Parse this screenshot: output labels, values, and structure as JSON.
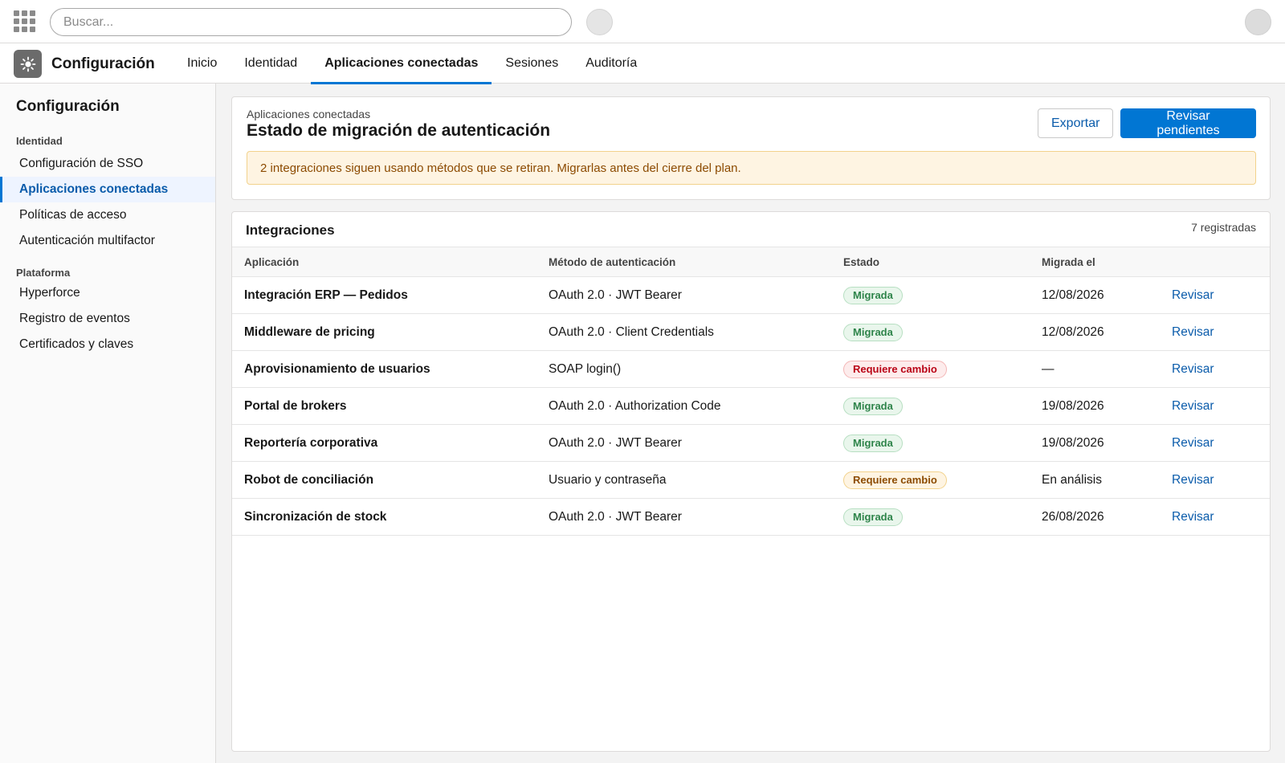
{
  "topbar": {
    "search_placeholder": "Buscar..."
  },
  "nav": {
    "app_name": "Configuración",
    "tabs": [
      "Inicio",
      "Identidad",
      "Aplicaciones conectadas",
      "Sesiones",
      "Auditoría"
    ],
    "active_tab": "Aplicaciones conectadas"
  },
  "sidebar": {
    "title": "Configuración",
    "groups": [
      {
        "label": "Identidad",
        "items": [
          "Configuración de SSO",
          "Aplicaciones conectadas",
          "Políticas de acceso",
          "Autenticación multifactor"
        ]
      },
      {
        "label": "Plataforma",
        "items": [
          "Hyperforce",
          "Registro de eventos",
          "Certificados y claves"
        ]
      }
    ],
    "active_item": "Aplicaciones conectadas"
  },
  "header": {
    "eyebrow": "Aplicaciones conectadas",
    "title": "Estado de migración de autenticación",
    "export_label": "Exportar",
    "review_label": "Revisar pendientes",
    "alert": "2 integraciones siguen usando métodos que se retiran. Migrarlas antes del cierre del plan."
  },
  "table": {
    "title": "Integraciones",
    "count": "7 registradas",
    "columns": [
      "Aplicación",
      "Método de autenticación",
      "Estado",
      "Migrada el",
      ""
    ],
    "rows": [
      {
        "app": "Integración ERP — Pedidos",
        "method": "OAuth 2.0 · JWT Bearer",
        "status": "Migrada",
        "status_kind": "green",
        "date": "12/08/2026",
        "action": "Revisar"
      },
      {
        "app": "Middleware de pricing",
        "method": "OAuth 2.0 · Client Credentials",
        "status": "Migrada",
        "status_kind": "green",
        "date": "12/08/2026",
        "action": "Revisar"
      },
      {
        "app": "Aprovisionamiento de usuarios",
        "method": "SOAP login()",
        "status": "Requiere cambio",
        "status_kind": "red",
        "date": "—",
        "action": "Revisar"
      },
      {
        "app": "Portal de brokers",
        "method": "OAuth 2.0 · Authorization Code",
        "status": "Migrada",
        "status_kind": "green",
        "date": "19/08/2026",
        "action": "Revisar"
      },
      {
        "app": "Reportería corporativa",
        "method": "OAuth 2.0 · JWT Bearer",
        "status": "Migrada",
        "status_kind": "green",
        "date": "19/08/2026",
        "action": "Revisar"
      },
      {
        "app": "Robot de conciliación",
        "method": "Usuario y contraseña",
        "status": "Requiere cambio",
        "status_kind": "amber",
        "date": "En análisis",
        "action": "Revisar"
      },
      {
        "app": "Sincronización de stock",
        "method": "OAuth 2.0 · JWT Bearer",
        "status": "Migrada",
        "status_kind": "green",
        "date": "26/08/2026",
        "action": "Revisar"
      }
    ]
  },
  "icons": {
    "launcher": "app-launcher-icon",
    "settings": "gear-icon"
  },
  "colors": {
    "brand": "#0176d3",
    "link": "#0b5cab",
    "success": "#2e844a",
    "error": "#ba0517",
    "warning": "#8c4b02"
  }
}
